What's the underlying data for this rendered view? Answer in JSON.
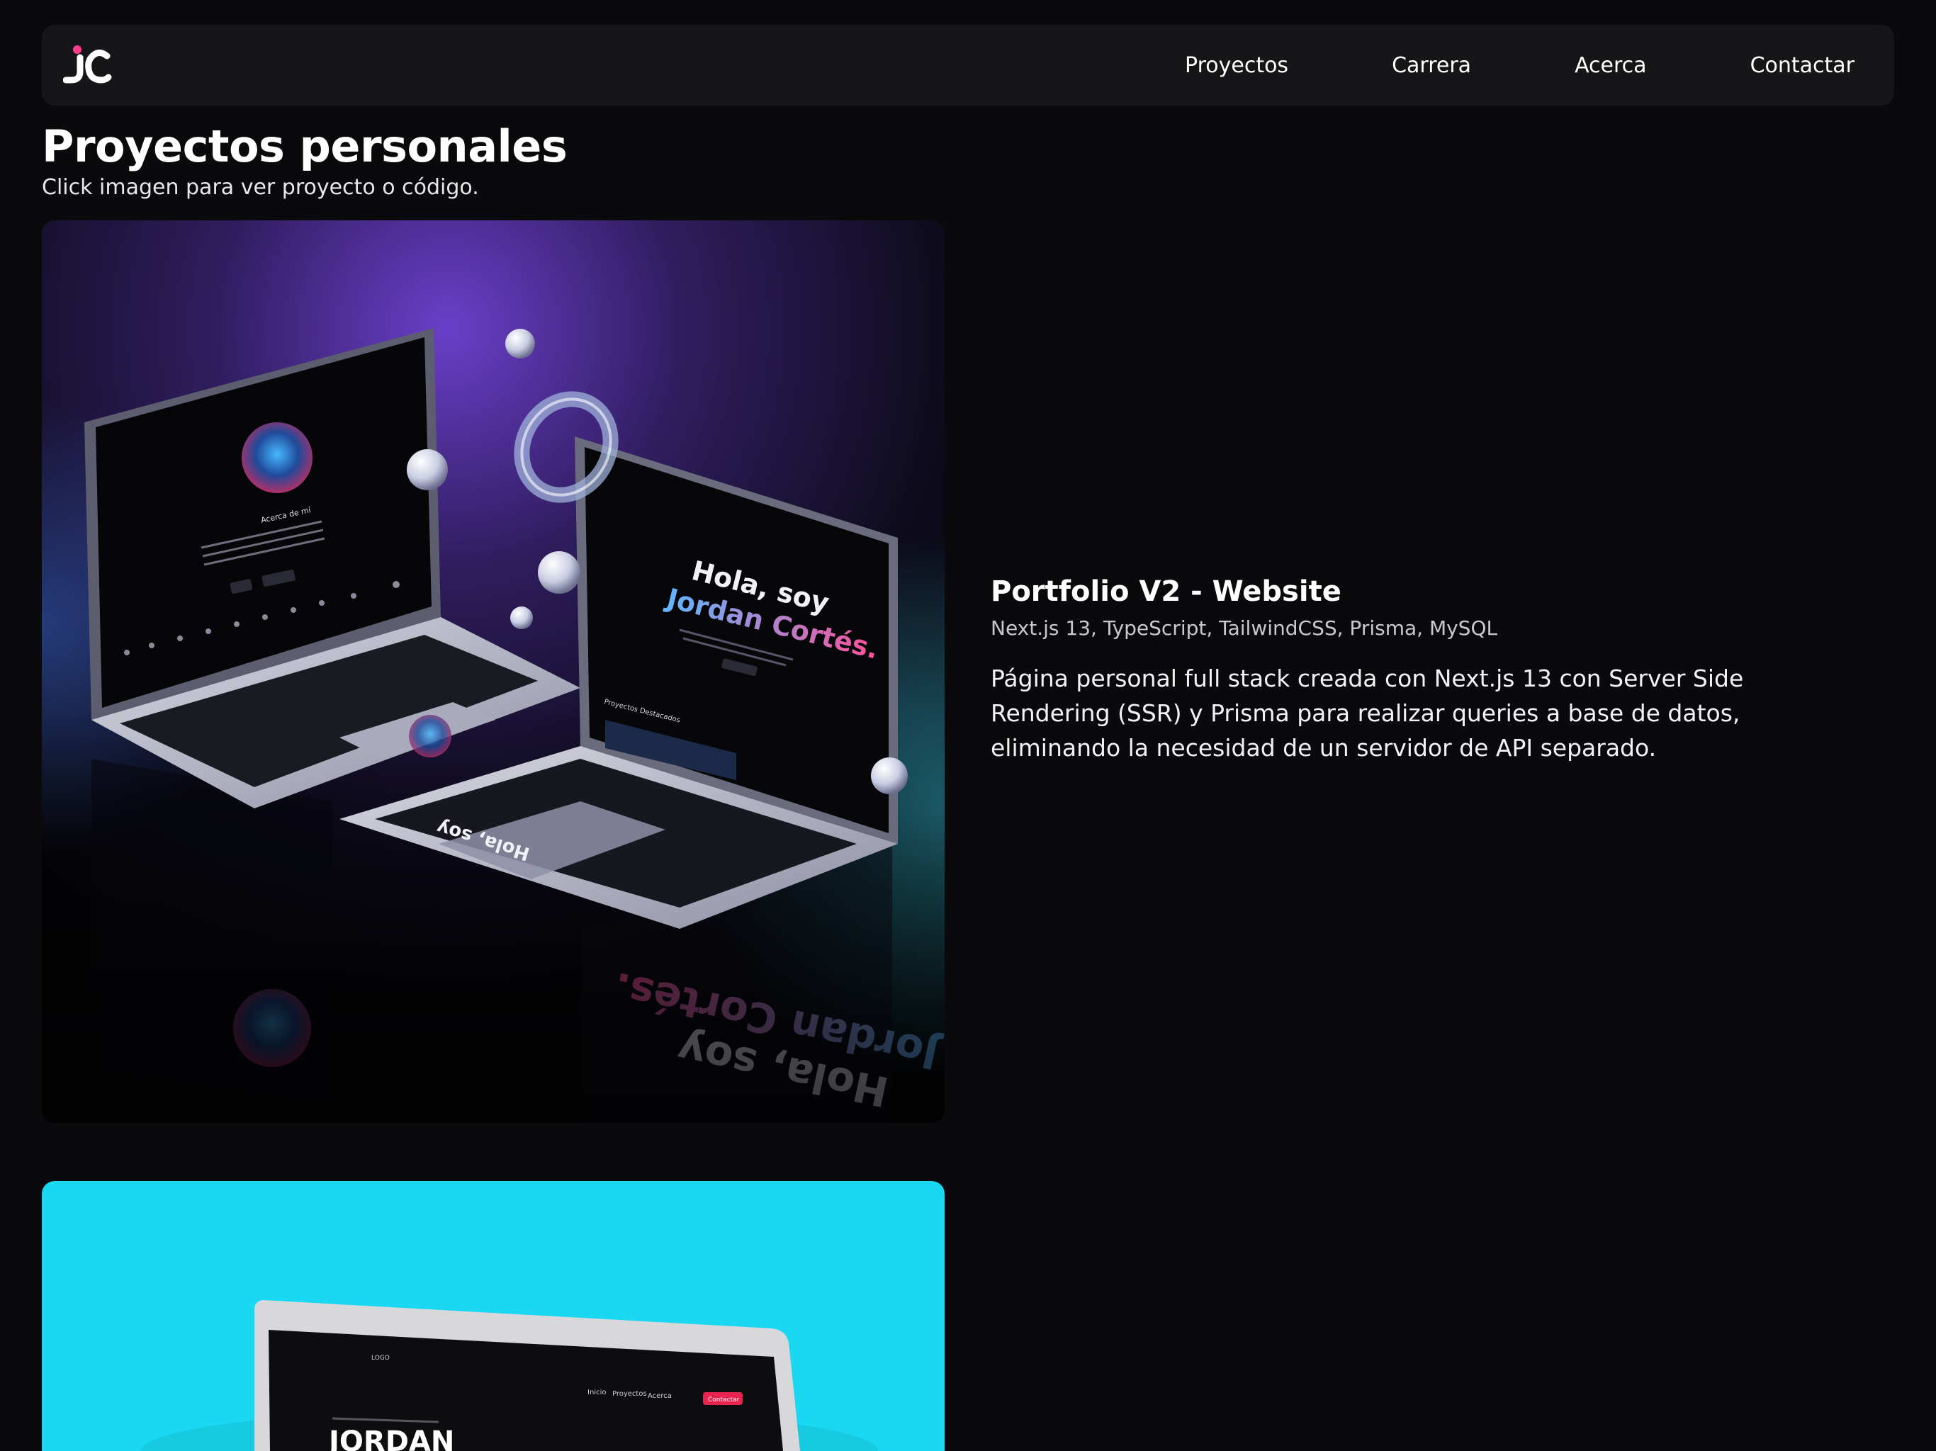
{
  "brand": {
    "logo_text": "JC",
    "accent_color": "#ff3d8a"
  },
  "nav": {
    "items": [
      {
        "label": "Proyectos"
      },
      {
        "label": "Carrera"
      },
      {
        "label": "Acerca"
      },
      {
        "label": "Contactar"
      }
    ]
  },
  "page": {
    "title": "Proyectos personales",
    "subtitle": "Click imagen para ver proyecto o código."
  },
  "projects": [
    {
      "title": "Portfolio V2 - Website",
      "tech": "Next.js 13, TypeScript, TailwindCSS, Prisma, MySQL",
      "description": "Página personal full stack creada con Next.js 13 con Server Side Rendering (SSR) y Prisma para realizar queries a base de datos, eliminando la necesidad de un servidor de API separado.",
      "image": {
        "screen_hero_line1": "Hola, soy",
        "screen_hero_line2": "Jordan Cortés.",
        "screen_about_heading": "Acerca de mí",
        "screen_section_label": "Proyectos Destacados"
      }
    },
    {
      "image": {
        "background_color": "#1ad8f2",
        "screen_hero_name": "JORDAN",
        "screen_logo": "LOGO",
        "screen_nav": [
          "Inicio",
          "Proyectos",
          "Acerca"
        ],
        "screen_button": "Contactar"
      }
    }
  ]
}
